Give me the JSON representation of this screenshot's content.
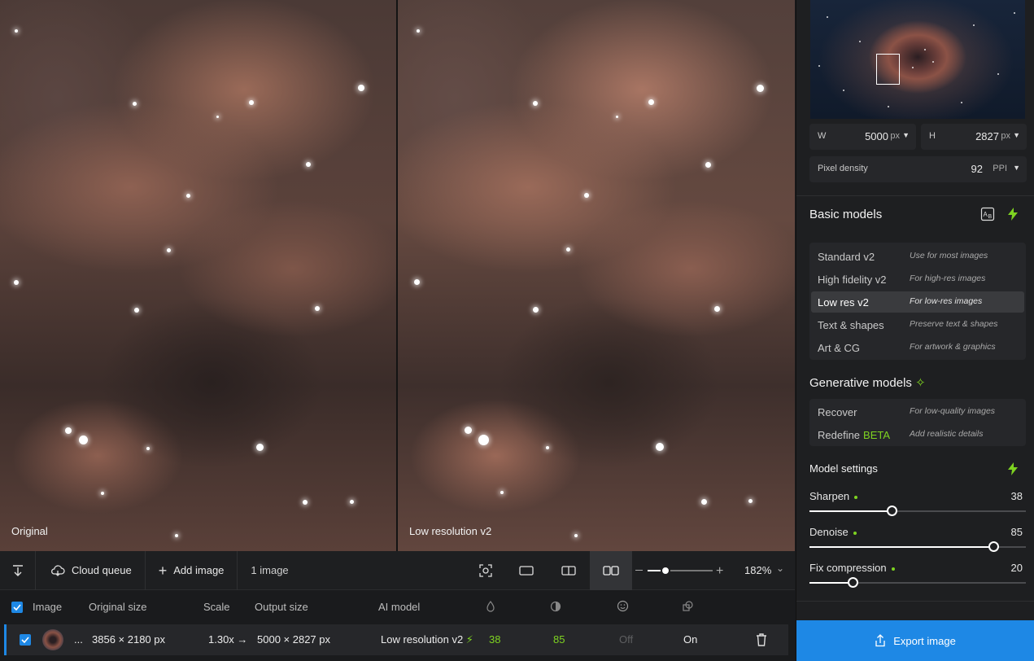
{
  "preview": {
    "left_label": "Original",
    "right_label": "Low resolution v2"
  },
  "toolbar": {
    "download_icon": "arrow-down-icon",
    "cloud_label": "Cloud queue",
    "add_label": "Add image",
    "count": "1 image",
    "zoom": "182%",
    "zoom_level": 0.27
  },
  "table": {
    "headers": {
      "image": "Image",
      "original_size": "Original size",
      "scale": "Scale",
      "output_size": "Output size",
      "ai_model": "AI model"
    },
    "row": {
      "dots": "...",
      "original_size": "3856 × 2180 px",
      "scale": "1.30x →",
      "output_size": "5000 × 2827 px",
      "model": "Low resolution v2",
      "sharpen": "38",
      "denoise": "85",
      "face": "Off",
      "color": "On"
    }
  },
  "dimensions": {
    "w_label": "W",
    "w_value": "5000",
    "h_label": "H",
    "h_value": "2827",
    "unit": "px",
    "density_label": "Pixel density",
    "density_value": "92",
    "density_unit": "PPI"
  },
  "basic_models": {
    "title": "Basic models",
    "items": [
      {
        "name": "Standard v2",
        "desc": "Use for most images"
      },
      {
        "name": "High fidelity v2",
        "desc": "For high-res images"
      },
      {
        "name": "Low res v2",
        "desc": "For low-res images",
        "selected": true
      },
      {
        "name": "Text & shapes",
        "desc": "Preserve text & shapes"
      },
      {
        "name": "Art & CG",
        "desc": "For artwork & graphics"
      }
    ]
  },
  "generative_models": {
    "title": "Generative models",
    "items": [
      {
        "name": "Recover",
        "desc": "For low-quality images"
      },
      {
        "name": "Redefine",
        "badge": "BETA",
        "desc": "Add realistic details"
      }
    ]
  },
  "model_settings": {
    "title": "Model settings",
    "sharpen_label": "Sharpen",
    "sharpen_value": "38",
    "denoise_label": "Denoise",
    "denoise_value": "85",
    "fix_label": "Fix compression",
    "fix_value": "20"
  },
  "export_label": "Export image",
  "colors": {
    "accent": "#1e88e5",
    "green": "#7ed321"
  }
}
